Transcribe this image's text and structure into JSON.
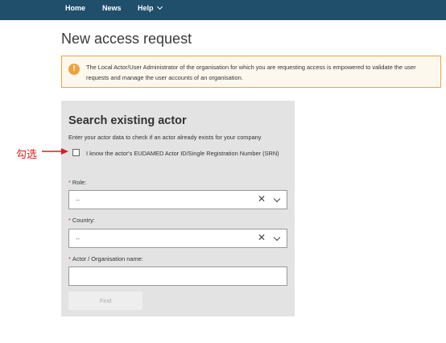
{
  "nav": {
    "home": "Home",
    "news": "News",
    "help": "Help"
  },
  "page": {
    "title": "New access request"
  },
  "notice": {
    "icon": "exclamation-icon",
    "text": "The Local Actor/User Administrator of the organisation for which you are requesting access is empowered to validate the user requests and manage the user accounts of an organisation."
  },
  "search": {
    "title": "Search existing actor",
    "description": "Enter your actor data to check if an actor already exists for your company",
    "srn_checkbox_label": "I know the actor's EUDAMED Actor ID/Single Registration Number (SRN)",
    "srn_checked": false,
    "role_label": "Role:",
    "role_value": "--",
    "country_label": "Country:",
    "country_value": "--",
    "name_label": "Actor / Organisation name:",
    "name_value": "",
    "required_mark": "*",
    "find_label": "Find"
  },
  "annotation": {
    "text": "勾选",
    "color": "#e11b1b"
  },
  "colors": {
    "nav_bg": "#1f4f6b",
    "notice_border": "#f0a23a",
    "panel_bg": "#e3e3e3"
  }
}
